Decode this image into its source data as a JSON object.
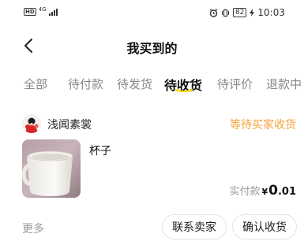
{
  "status_bar": {
    "network_badge": "HD",
    "network_type": "4G",
    "battery": "82",
    "time": "10:03"
  },
  "header": {
    "title": "我买到的",
    "back_icon": "chevron-left-icon"
  },
  "tabs": [
    {
      "label": "全部",
      "active": false
    },
    {
      "label": "待付款",
      "active": false
    },
    {
      "label": "待发货",
      "active": false
    },
    {
      "label": "待收货",
      "active": true
    },
    {
      "label": "待评价",
      "active": false
    },
    {
      "label": "退款中",
      "active": false
    }
  ],
  "order": {
    "seller_name": "浅闻素裳",
    "status": "等待买家收货",
    "product_name": "杯子",
    "price_label": "实付款",
    "price_currency": "¥",
    "price_integer": "0",
    "price_decimal": ".01",
    "more_label": "更多",
    "contact_button": "联系卖家",
    "confirm_button": "确认收货"
  },
  "colors": {
    "accent": "#f2a23a",
    "tab_underline": "#ffd400",
    "text_primary": "#111111",
    "text_secondary": "#999999"
  }
}
